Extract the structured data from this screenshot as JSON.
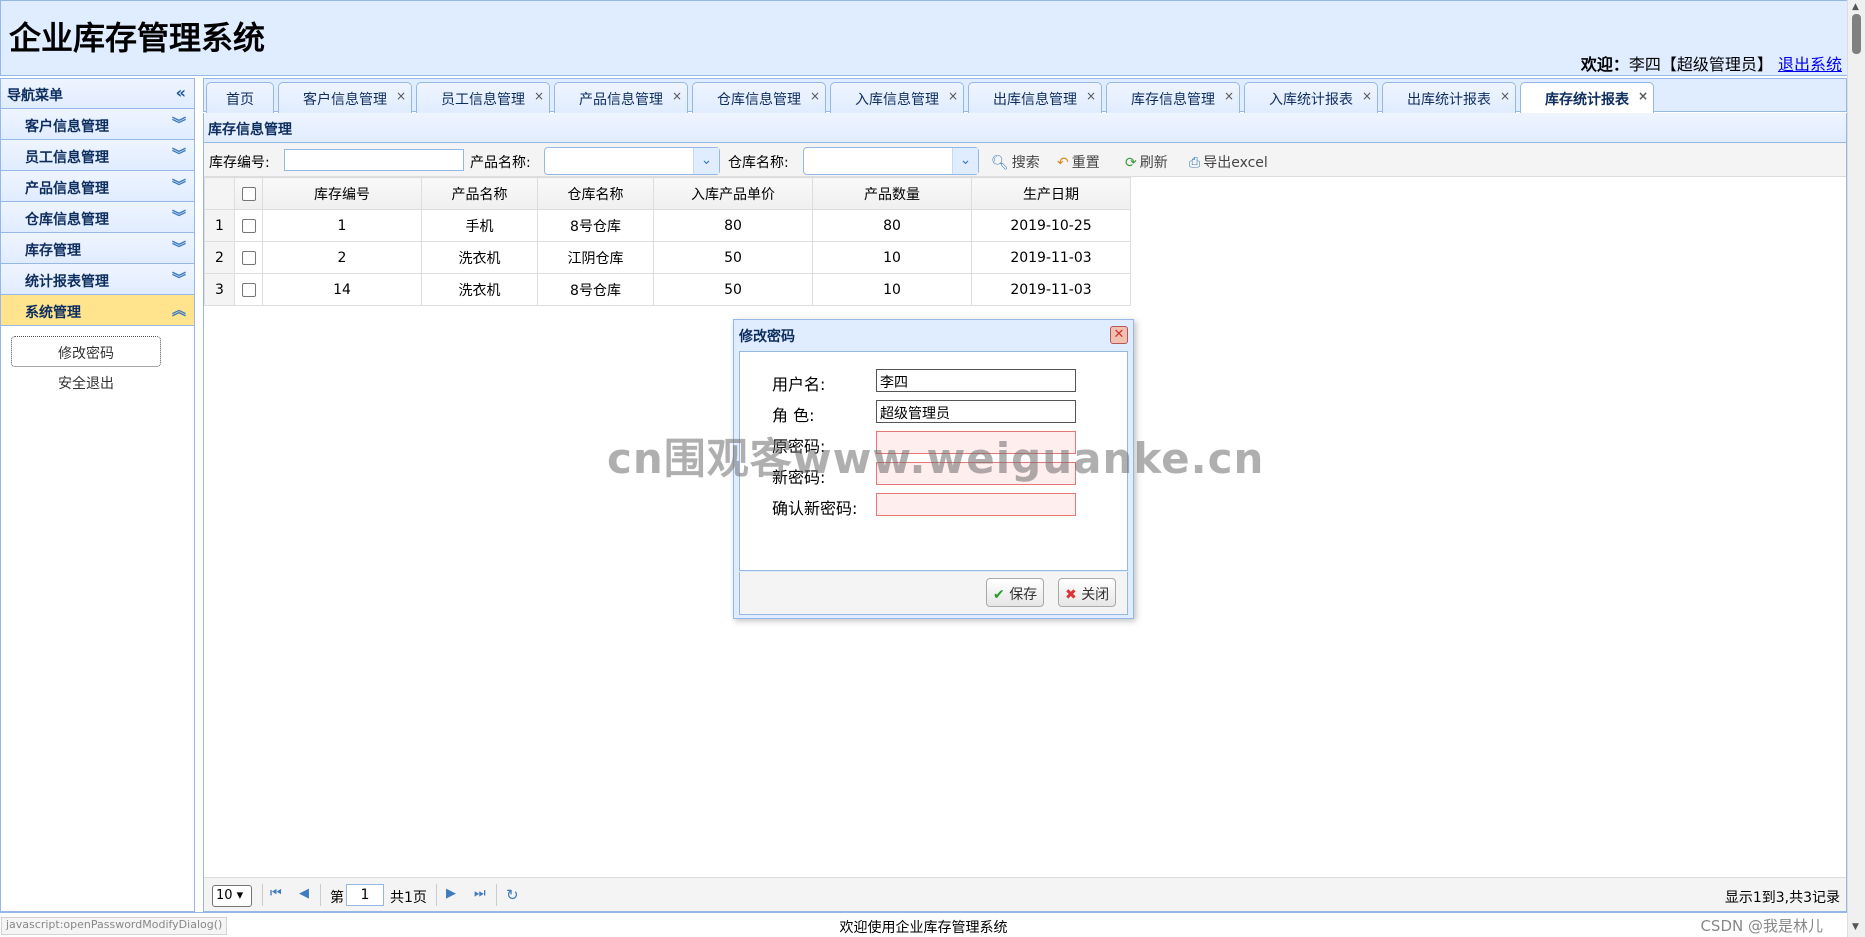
{
  "app": {
    "title": "企业库存管理系统"
  },
  "header": {
    "welcome_label": "欢迎：",
    "user": "李四【超级管理员】",
    "logout": "退出系统"
  },
  "sidebar": {
    "title": "导航菜单",
    "items": [
      {
        "label": "客户信息管理"
      },
      {
        "label": "员工信息管理"
      },
      {
        "label": "产品信息管理"
      },
      {
        "label": "仓库信息管理"
      },
      {
        "label": "库存管理"
      },
      {
        "label": "统计报表管理"
      },
      {
        "label": "系统管理"
      }
    ],
    "sub_items": [
      {
        "label": "修改密码"
      },
      {
        "label": "安全退出"
      }
    ]
  },
  "tabs": [
    {
      "label": "首页"
    },
    {
      "label": "客户信息管理"
    },
    {
      "label": "员工信息管理"
    },
    {
      "label": "产品信息管理"
    },
    {
      "label": "仓库信息管理"
    },
    {
      "label": "入库信息管理"
    },
    {
      "label": "出库信息管理"
    },
    {
      "label": "库存信息管理"
    },
    {
      "label": "入库统计报表"
    },
    {
      "label": "出库统计报表"
    },
    {
      "label": "库存统计报表"
    }
  ],
  "panel": {
    "title": "库存信息管理"
  },
  "toolbar": {
    "stock_no_label": "库存编号:",
    "product_name_label": "产品名称:",
    "warehouse_name_label": "仓库名称:",
    "search": "搜索",
    "reset": "重置",
    "refresh": "刷新",
    "export": "导出excel"
  },
  "grid": {
    "columns": [
      "库存编号",
      "产品名称",
      "仓库名称",
      "入库产品单价",
      "产品数量",
      "生产日期"
    ],
    "rows": [
      {
        "n": "1",
        "id": "1",
        "product": "手机",
        "warehouse": "8号仓库",
        "price": "80",
        "qty": "80",
        "date": "2019-10-25"
      },
      {
        "n": "2",
        "id": "2",
        "product": "洗衣机",
        "warehouse": "江阴仓库",
        "price": "50",
        "qty": "10",
        "date": "2019-11-03"
      },
      {
        "n": "3",
        "id": "14",
        "product": "洗衣机",
        "warehouse": "8号仓库",
        "price": "50",
        "qty": "10",
        "date": "2019-11-03"
      }
    ]
  },
  "pager": {
    "page_size": "10",
    "page_prefix": "第",
    "page": "1",
    "page_suffix": "共1页",
    "info": "显示1到3,共3记录"
  },
  "dialog": {
    "title": "修改密码",
    "username_label": "用户名:",
    "username": "李四",
    "role_label": "角 色:",
    "role": "超级管理员",
    "old_pwd_label": "原密码:",
    "new_pwd_label": "新密码:",
    "confirm_pwd_label": "确认新密码:",
    "save": "保存",
    "close": "关闭"
  },
  "status": {
    "link": "javascript:openPasswordModifyDialog()",
    "text": "欢迎使用企业库存管理系统",
    "credit": "CSDN @我是林儿"
  },
  "watermark": "cn围观客www.weiguanke.cn"
}
